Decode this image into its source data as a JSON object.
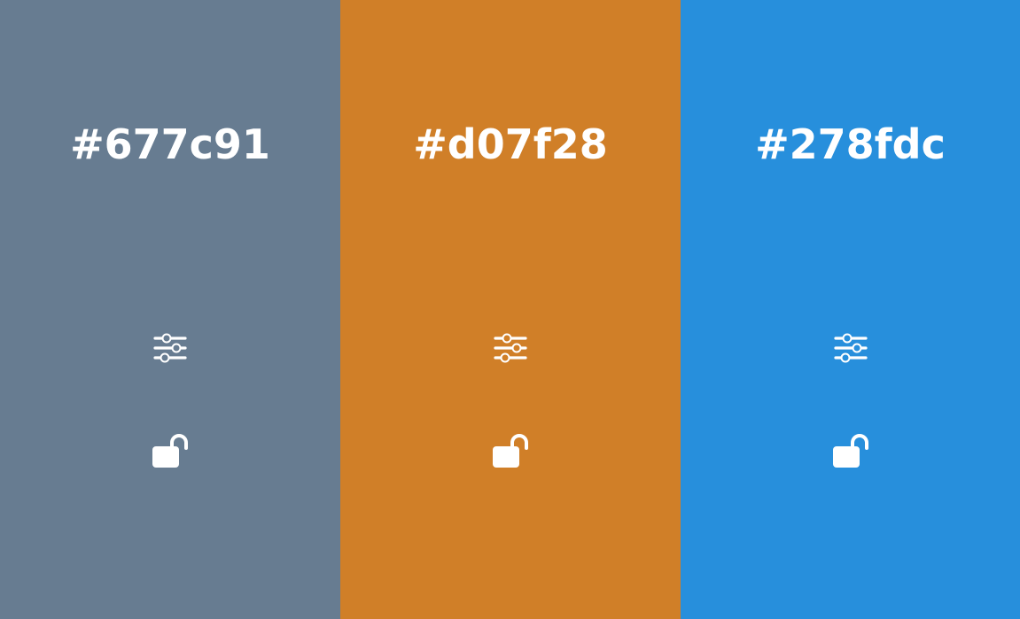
{
  "colors": [
    {
      "hex_label": "#677c91",
      "background": "#677c91",
      "adjust_icon": "sliders-icon",
      "lock_icon": "unlock-icon"
    },
    {
      "hex_label": "#d07f28",
      "background": "#d07f28",
      "adjust_icon": "sliders-icon",
      "lock_icon": "unlock-icon"
    },
    {
      "hex_label": "#278fdc",
      "background": "#278fdc",
      "adjust_icon": "sliders-icon",
      "lock_icon": "unlock-icon"
    }
  ],
  "icon_color": "#ffffff"
}
